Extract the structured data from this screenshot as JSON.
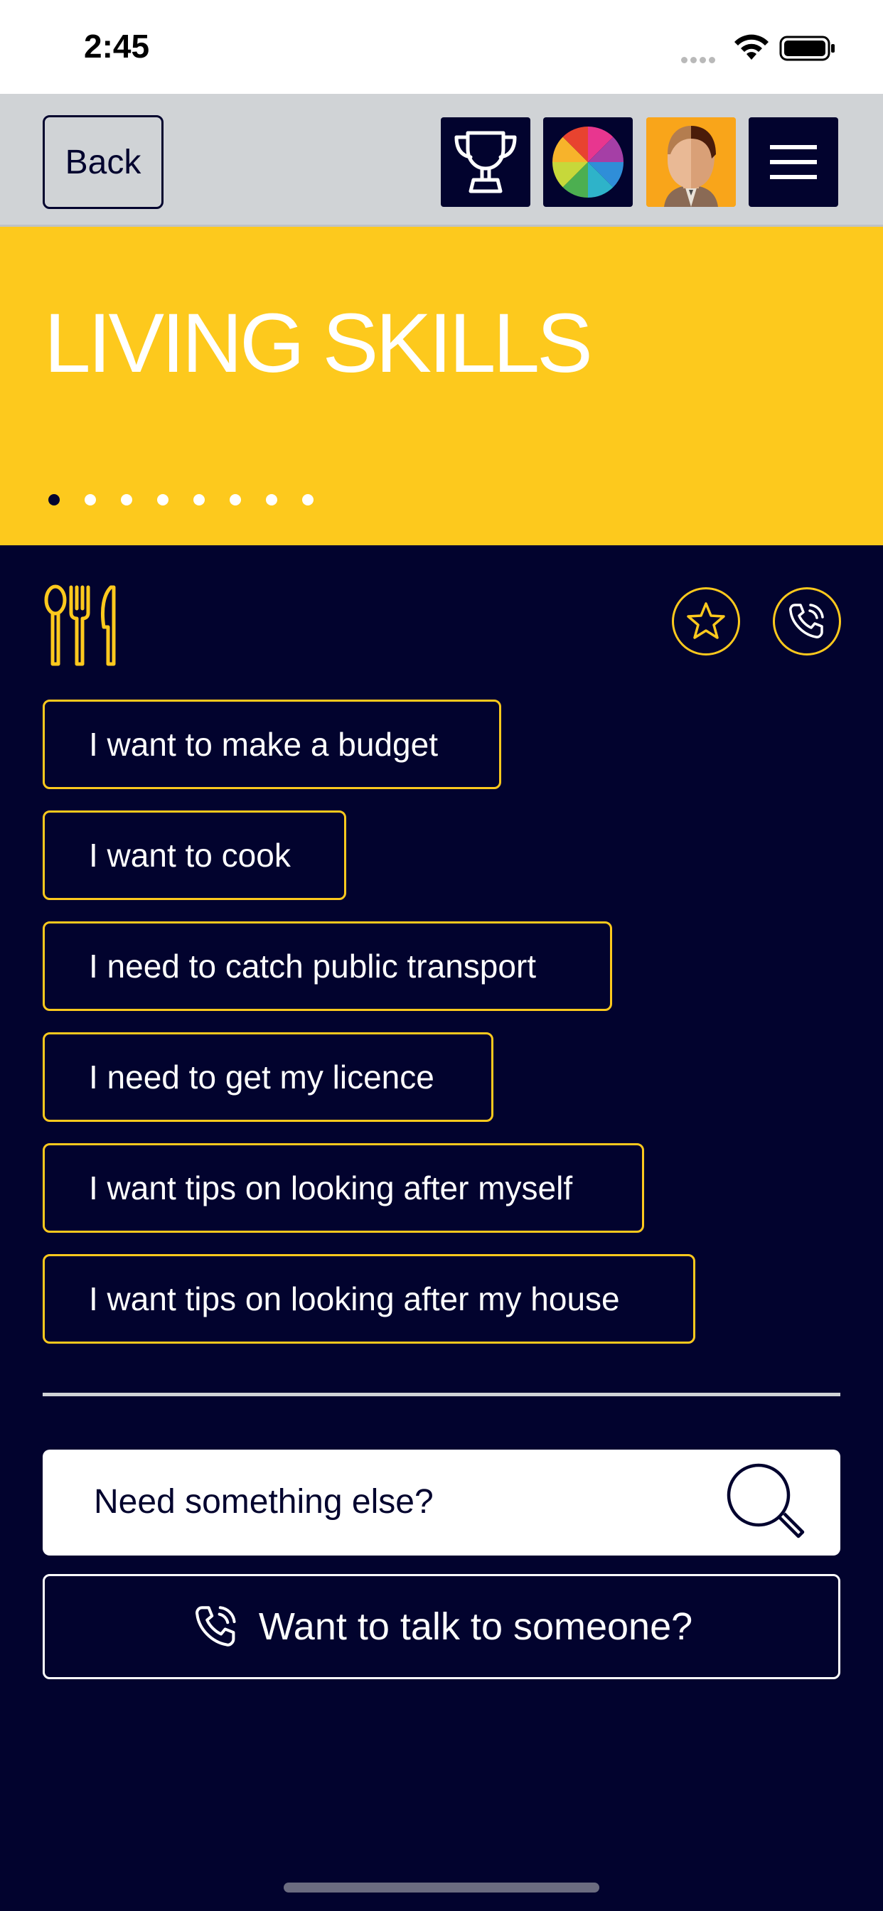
{
  "status_bar": {
    "time": "2:45"
  },
  "nav": {
    "back_label": "Back",
    "icons": [
      "trophy-icon",
      "color-wheel-icon",
      "avatar-icon",
      "hamburger-menu-icon"
    ]
  },
  "hero": {
    "title": "LIVING SKILLS",
    "page_count": 8,
    "active_page": 1
  },
  "category_icon": "utensils-icon",
  "options": [
    "I want to make a budget",
    "I want to cook",
    "I need to catch public transport",
    "I need to get my licence",
    "I want tips on looking after myself",
    "I want tips on looking after my house"
  ],
  "search": {
    "placeholder": "Need something else?"
  },
  "talk_button_label": "Want to talk to someone?",
  "colors": {
    "navy": "#02032e",
    "yellow": "#fdc91d",
    "grey": "#d0d3d6",
    "white": "#ffffff"
  }
}
